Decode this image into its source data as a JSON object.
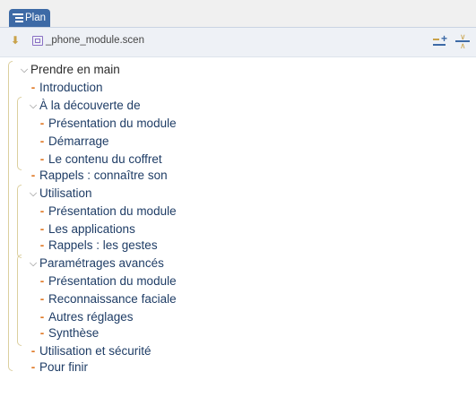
{
  "tab": {
    "label": "Plan",
    "icon": "outline-icon"
  },
  "toolbar": {
    "toggle_icon": "double-chevron-down-icon",
    "file_icon": "scenario-file-icon",
    "file_name": "_phone_module.scen",
    "expand_all_icon": "expand-all-icon",
    "collapse_all_icon": "collapse-all-icon"
  },
  "tree": {
    "root": {
      "label": "Prendre en main",
      "expanded": true
    },
    "items": [
      {
        "label": "Introduction",
        "type": "leaf"
      },
      {
        "label": "À la découverte de",
        "type": "folder"
      },
      {
        "label": "Présentation du module",
        "type": "leaf"
      },
      {
        "label": "Démarrage",
        "type": "leaf"
      },
      {
        "label": "Le contenu du coffret",
        "type": "leaf"
      },
      {
        "label": "Rappels : connaître son",
        "type": "leaf"
      },
      {
        "label": "Utilisation",
        "type": "folder"
      },
      {
        "label": "Présentation du module",
        "type": "leaf"
      },
      {
        "label": "Les applications",
        "type": "leaf"
      },
      {
        "label": "Rappels : les gestes",
        "type": "leaf"
      },
      {
        "label": "Paramétrages avancés",
        "type": "folder"
      },
      {
        "label": "Présentation du module",
        "type": "leaf"
      },
      {
        "label": "Reconnaissance faciale",
        "type": "leaf"
      },
      {
        "label": "Autres réglages",
        "type": "leaf"
      },
      {
        "label": "Synthèse",
        "type": "leaf"
      },
      {
        "label": "Utilisation et sécurité",
        "type": "leaf"
      },
      {
        "label": "Pour finir",
        "type": "leaf"
      }
    ]
  },
  "colors": {
    "tab_bg": "#3d6aa6",
    "leaf_marker": "#e07a28",
    "item_text": "#1f3d66",
    "bracket": "#dccf9e"
  }
}
